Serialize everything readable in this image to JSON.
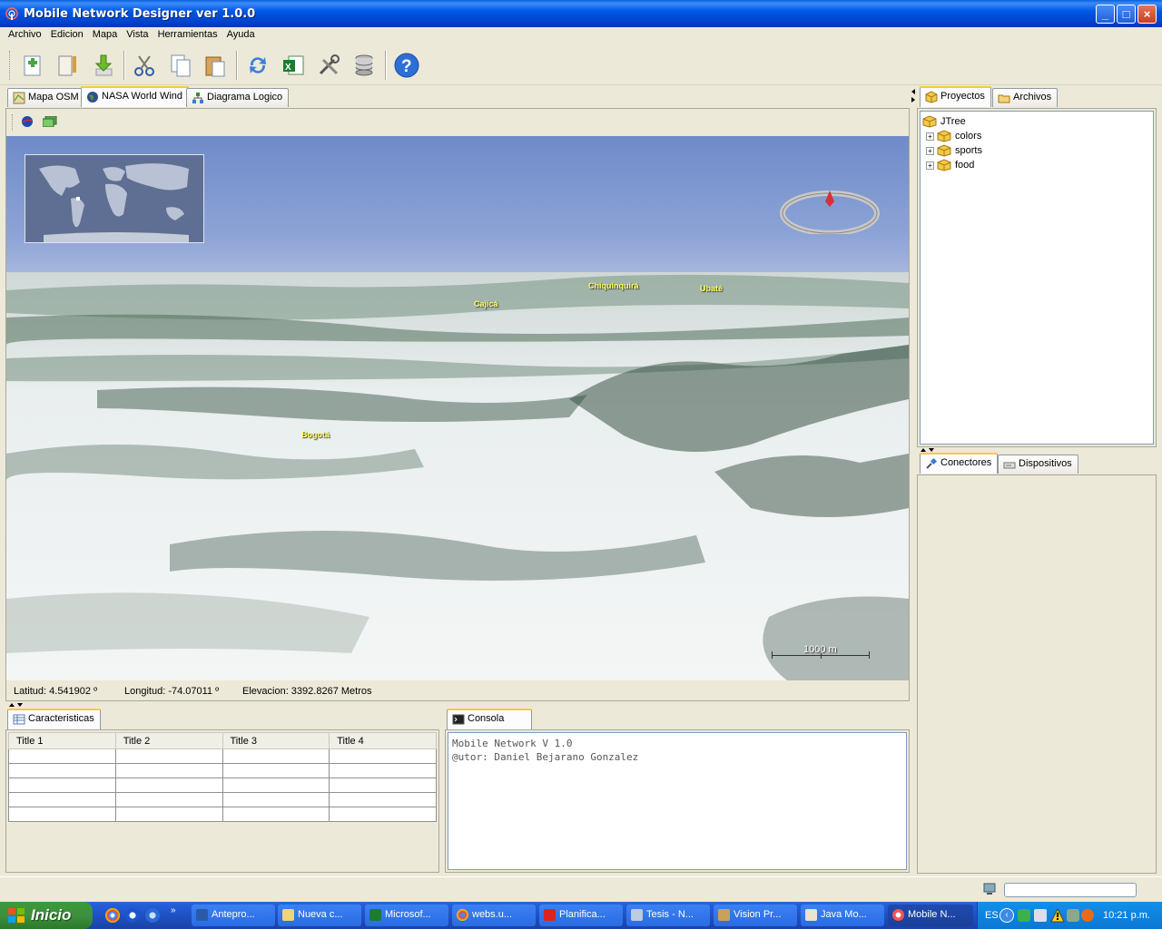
{
  "window": {
    "title": "Mobile Network Designer ver 1.0.0"
  },
  "menu": [
    "Archivo",
    "Edicion",
    "Mapa",
    "Vista",
    "Herramientas",
    "Ayuda"
  ],
  "toolbar": [
    "new-icon",
    "edit-icon",
    "download-icon",
    "cut-icon",
    "copy-icon",
    "paste-icon",
    "refresh-icon",
    "excel-icon",
    "tools-icon",
    "database-icon",
    "help-icon"
  ],
  "main_tabs": [
    {
      "label": "Mapa OSM"
    },
    {
      "label": "NASA World Wind"
    },
    {
      "label": "Diagrama Logico"
    }
  ],
  "map": {
    "places": [
      "Chiquinquirá",
      "Ubaté",
      "Cajicá",
      "Bogotá"
    ],
    "scale_label": "1000 m",
    "latitud": "Latitud: 4.541902 º",
    "longitud": "Longitud: -74.07011 º",
    "elevacion": "Elevacion: 3392.8267 Metros"
  },
  "characteristics": {
    "tab": "Caracteristicas",
    "columns": [
      "Title 1",
      "Title 2",
      "Title 3",
      "Title 4"
    ]
  },
  "console": {
    "tab": "Consola",
    "lines": [
      "Mobile Network V 1.0",
      "@utor: Daniel Bejarano Gonzalez"
    ]
  },
  "right_top_tabs": [
    {
      "label": "Proyectos"
    },
    {
      "label": "Archivos"
    }
  ],
  "tree": {
    "root": "JTree",
    "children": [
      "colors",
      "sports",
      "food"
    ]
  },
  "right_bottom_tabs": [
    {
      "label": "Conectores"
    },
    {
      "label": "Dispositivos"
    }
  ],
  "taskbar": {
    "start": "Inicio",
    "buttons": [
      "Antepro...",
      "Nueva c...",
      "Microsof...",
      "webs.u...",
      "Planifica...",
      "Tesis - N...",
      "Vision Pr...",
      "Java Mo...",
      "Mobile N..."
    ],
    "lang": "ES",
    "clock": "10:21 p.m."
  }
}
